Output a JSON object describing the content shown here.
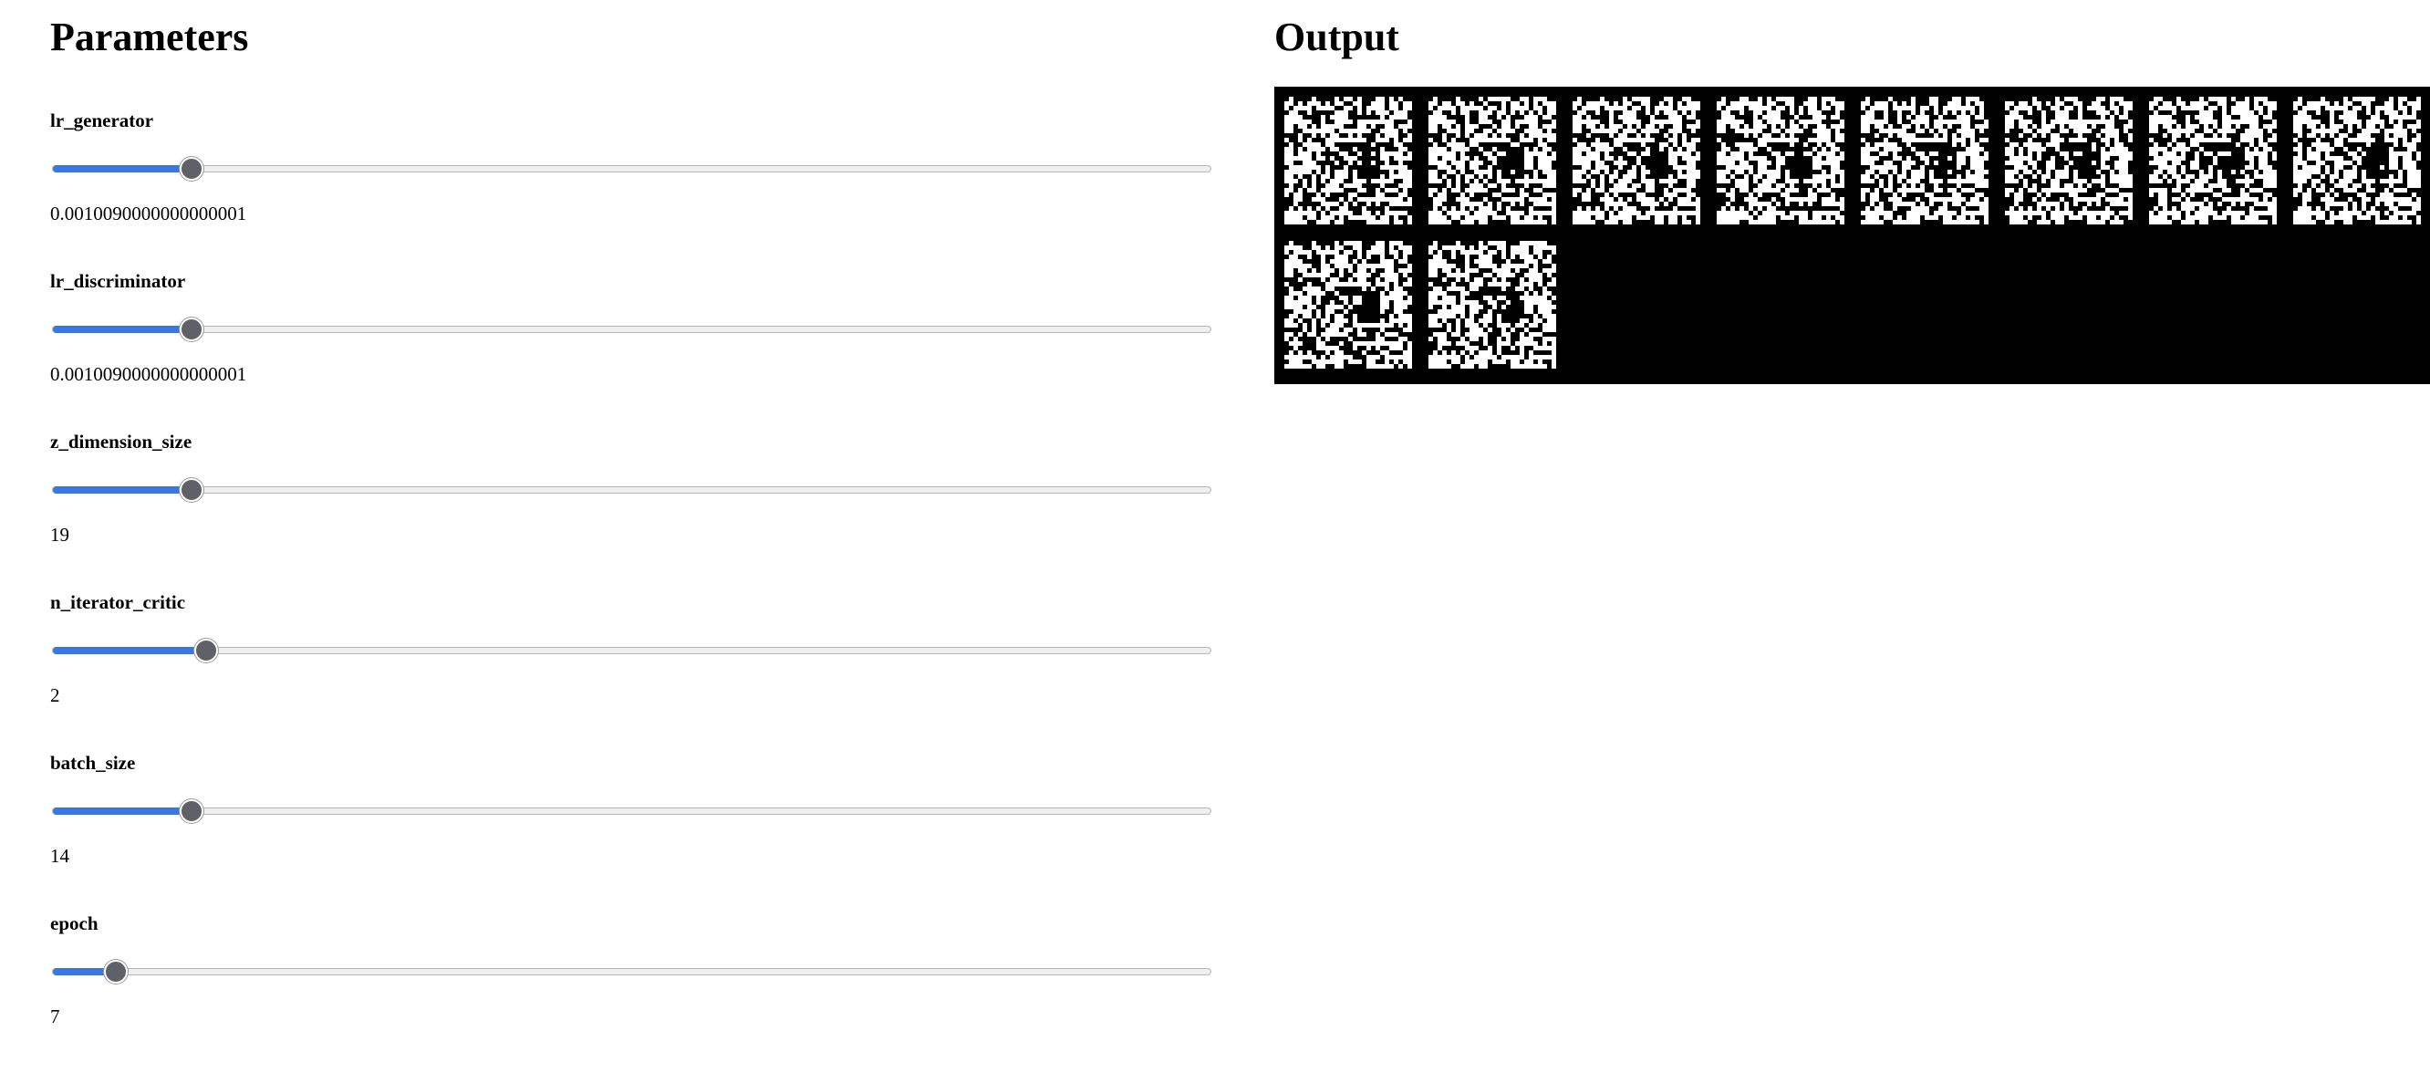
{
  "parameters": {
    "title": "Parameters",
    "items": [
      {
        "key": "lr_generator",
        "label": "lr_generator",
        "value": "0.0010090000000000001",
        "fraction": 0.12
      },
      {
        "key": "lr_discriminator",
        "label": "lr_discriminator",
        "value": "0.0010090000000000001",
        "fraction": 0.12
      },
      {
        "key": "z_dimension_size",
        "label": "z_dimension_size",
        "value": "19",
        "fraction": 0.12
      },
      {
        "key": "n_iterator_critic",
        "label": "n_iterator_critic",
        "value": "2",
        "fraction": 0.133
      },
      {
        "key": "batch_size",
        "label": "batch_size",
        "value": "14",
        "fraction": 0.12
      },
      {
        "key": "epoch",
        "label": "epoch",
        "value": "7",
        "fraction": 0.055
      }
    ]
  },
  "output": {
    "title": "Output",
    "image_count": 10,
    "background": "#000000",
    "pixel_color": "#ffffff"
  },
  "colors": {
    "slider_fill": "#3b77e2",
    "slider_track": "#efefef",
    "slider_thumb": "#5f6068"
  }
}
